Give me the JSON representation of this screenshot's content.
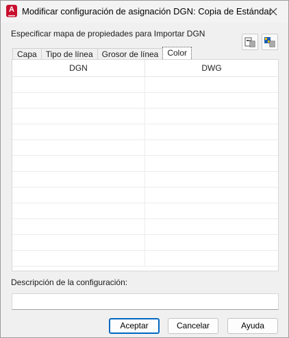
{
  "window": {
    "title": "Modificar configuración de asignación DGN: Copia de Estándar",
    "app_icon_letter": "A"
  },
  "header": {
    "label": "Especificar mapa de propiedades para Importar DGN"
  },
  "toolbar": {
    "icons": [
      "export-mapping-icon",
      "import-mapping-icon"
    ]
  },
  "tabs": [
    {
      "label": "Capa"
    },
    {
      "label": "Tipo de línea"
    },
    {
      "label": "Grosor de línea"
    },
    {
      "label": "Color",
      "active": true
    }
  ],
  "table": {
    "columns": [
      "DGN",
      "DWG"
    ],
    "row_count": 12
  },
  "description": {
    "label": "Descripción de la configuración:",
    "value": ""
  },
  "buttons": {
    "accept": "Aceptar",
    "cancel": "Cancelar",
    "help": "Ayuda"
  },
  "colors": {
    "accent": "#0067c0",
    "app_icon": "#c8102e"
  }
}
